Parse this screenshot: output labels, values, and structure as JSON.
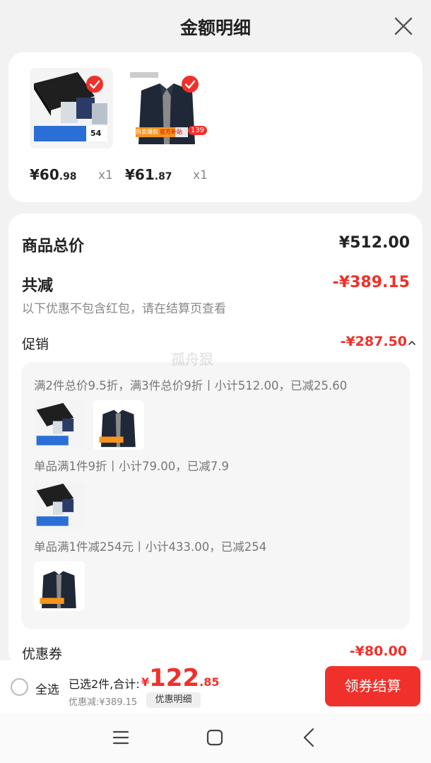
{
  "header": {
    "title": "金额明细"
  },
  "products": [
    {
      "image": "underwear-gift-box",
      "price_int": "¥60",
      "price_dec": ".98",
      "qty": "x1",
      "box_badge": "54"
    },
    {
      "image": "dark-jacket",
      "price_int": "¥61",
      "price_dec": ".87",
      "qty": "x1",
      "tag_left": "热卖爆款",
      "tag_right": "官方补贴",
      "tag_badge": "139"
    }
  ],
  "summary": {
    "total_label": "商品总价",
    "total_value": "¥512.00",
    "reduce_label": "共减",
    "reduce_value": "-¥389.15",
    "note": "以下优惠不包含红包，请在结算页查看",
    "promo_label": "促销",
    "promo_value": "-¥287.50",
    "coupon_label": "优惠券",
    "coupon_value": "-¥80.00"
  },
  "promo_rules": [
    {
      "text": "满2件总价9.5折，满3件总价9折丨小计512.00，已减25.60",
      "thumbs": [
        "underwear-gift-box",
        "dark-jacket"
      ]
    },
    {
      "text": "单品满1件9折丨小计79.00，已减7.9",
      "thumbs": [
        "underwear-gift-box"
      ]
    },
    {
      "text": "单品满1件减254元丨小计433.00，已减254",
      "thumbs": [
        "dark-jacket"
      ]
    }
  ],
  "watermark": "孤舟狠",
  "bottom_bar": {
    "select_all": "全选",
    "selected_text": "已选2件,合计:",
    "total_cur": "¥",
    "total_int": "122",
    "total_dec": ".85",
    "discount_text": "优惠减:¥389.15",
    "detail_button": "优惠明细",
    "checkout_button": "领券结算"
  },
  "colors": {
    "accent": "#f0302a",
    "background": "#f2f2f2",
    "card": "#ffffff"
  },
  "icons": {
    "close": "close-icon",
    "check": "check-icon",
    "menu": "menu-icon",
    "home": "home-icon",
    "back": "back-icon",
    "chevron": "chevron-up-icon"
  }
}
